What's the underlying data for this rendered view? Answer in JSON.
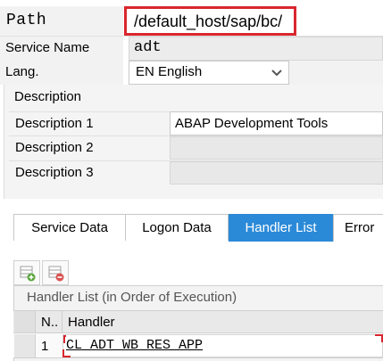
{
  "header": {
    "path_label": "Path",
    "path_value": "/default_host/sap/bc/",
    "service_name_label": "Service Name",
    "service_name_value": "adt",
    "lang_label": "Lang.",
    "lang_value": "EN English"
  },
  "description": {
    "title": "Description",
    "rows": [
      {
        "label": "Description 1",
        "value": "ABAP Development Tools"
      },
      {
        "label": "Description 2",
        "value": ""
      },
      {
        "label": "Description 3",
        "value": ""
      }
    ]
  },
  "tabs": [
    {
      "label": "Service Data",
      "active": false
    },
    {
      "label": "Logon Data",
      "active": false
    },
    {
      "label": "Handler List",
      "active": true
    },
    {
      "label": "Error",
      "active": false
    }
  ],
  "handler_list": {
    "caption": "Handler List (in Order of Execution)",
    "col_number": "N..",
    "col_handler": "Handler",
    "rows": [
      {
        "number": "1",
        "handler": "CL_ADT_WB_RES_APP"
      }
    ]
  },
  "toolbar": {
    "insert_icon": "insert-row-icon",
    "delete_icon": "delete-row-icon"
  },
  "colors": {
    "active_tab": "#2b8ad8",
    "highlight_box": "#d9262e"
  }
}
